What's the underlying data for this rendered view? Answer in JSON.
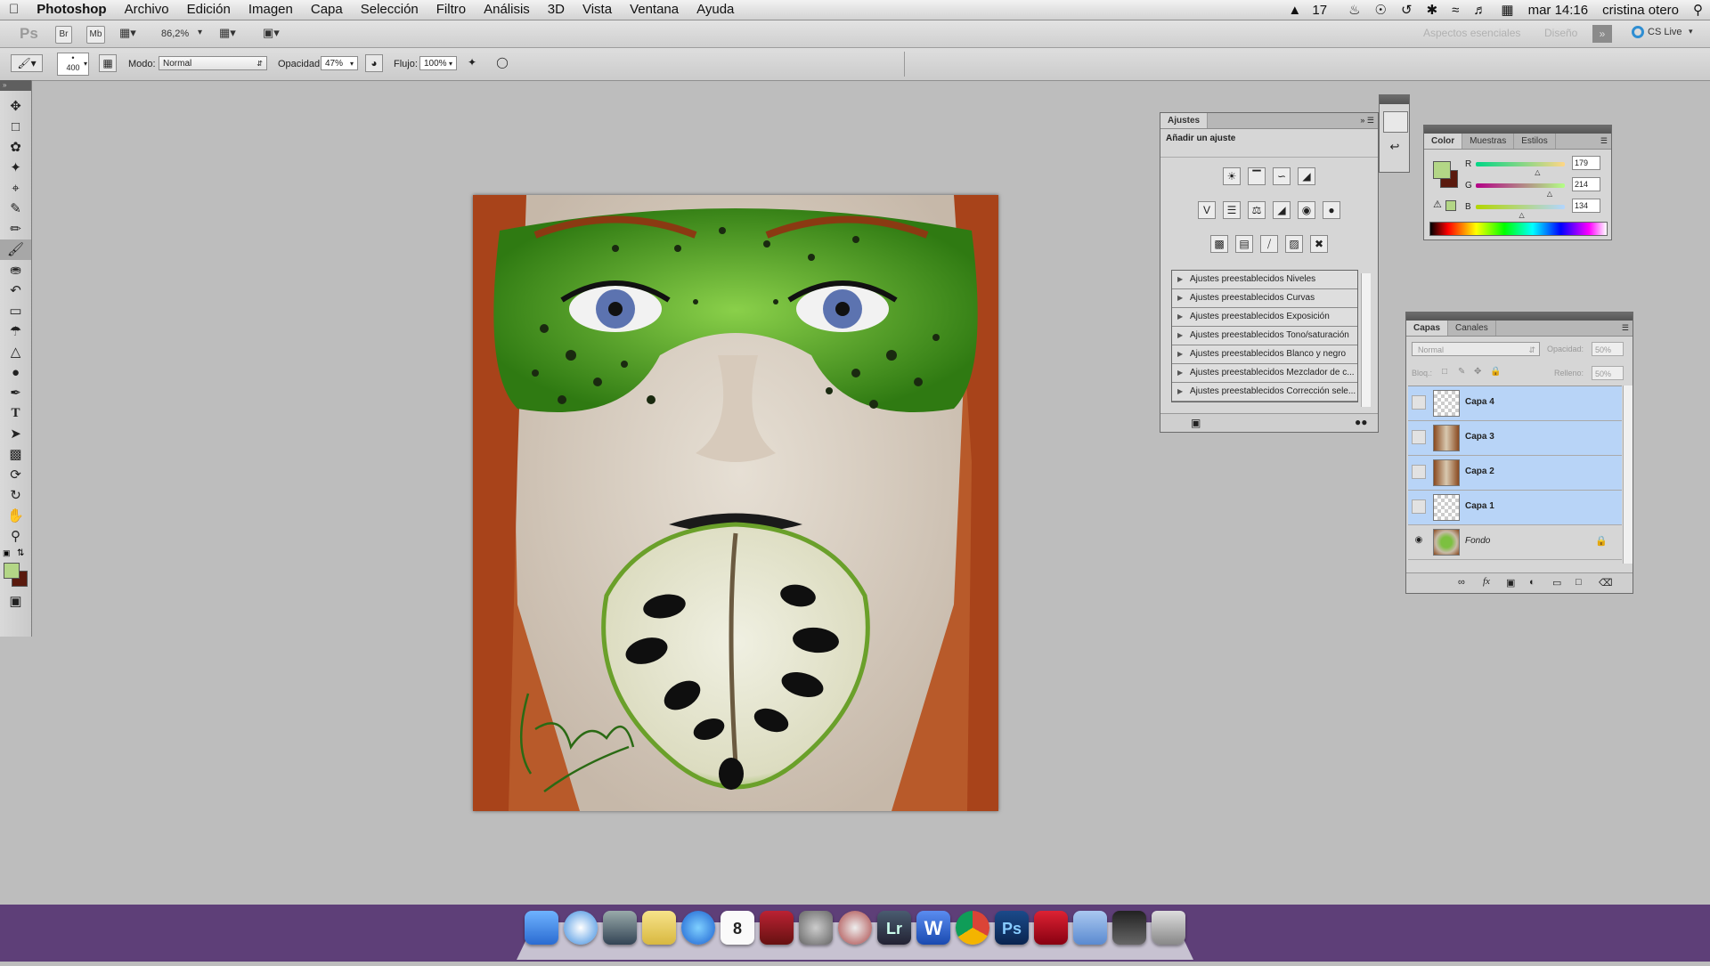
{
  "menubar": {
    "app_name": "Photoshop",
    "items": [
      "Archivo",
      "Edición",
      "Imagen",
      "Capa",
      "Selección",
      "Filtro",
      "Análisis",
      "3D",
      "Vista",
      "Ventana",
      "Ayuda"
    ],
    "status_badge": "17",
    "clock": "mar 14:16",
    "user": "cristina otero"
  },
  "appbar": {
    "ps_label": "Ps",
    "br_label": "Br",
    "mb_label": "Mb",
    "zoom": "86,2%",
    "workspace_essentials": "Aspectos esenciales",
    "workspace_design": "Diseño",
    "cs_live": "CS Live"
  },
  "options": {
    "brush_size": "400",
    "mode_label": "Modo:",
    "mode_value": "Normal",
    "opacity_label": "Opacidad:",
    "opacity_value": "47%",
    "flow_label": "Flujo:",
    "flow_value": "100%"
  },
  "adjustments": {
    "tab": "Ajustes",
    "heading": "Añadir un ajuste",
    "presets": [
      "Ajustes preestablecidos Niveles",
      "Ajustes preestablecidos Curvas",
      "Ajustes preestablecidos Exposición",
      "Ajustes preestablecidos Tono/saturación",
      "Ajustes preestablecidos Blanco y negro",
      "Ajustes preestablecidos Mezclador de c...",
      "Ajustes preestablecidos Corrección sele..."
    ]
  },
  "color": {
    "tabs": [
      "Color",
      "Muestras",
      "Estilos"
    ],
    "r_label": "R",
    "g_label": "G",
    "b_label": "B",
    "r": "179",
    "g": "214",
    "b": "134",
    "foreground": "#b3d686",
    "background": "#5a1a0e"
  },
  "layers": {
    "tabs": [
      "Capas",
      "Canales"
    ],
    "blend_mode": "Normal",
    "opacity_label": "Opacidad:",
    "opacity_value": "50%",
    "lock_label": "Bloq.:",
    "fill_label": "Relleno:",
    "fill_value": "50%",
    "items": [
      {
        "name": "Capa 4",
        "selected": true,
        "thumb": "transparent"
      },
      {
        "name": "Capa 3",
        "selected": true,
        "thumb": "photo"
      },
      {
        "name": "Capa 2",
        "selected": true,
        "thumb": "photo"
      },
      {
        "name": "Capa 1",
        "selected": true,
        "thumb": "transparent"
      },
      {
        "name": "Fondo",
        "selected": false,
        "thumb": "face"
      }
    ]
  },
  "dock": {
    "apps": [
      "finder-icon",
      "safari-icon",
      "facetime-icon",
      "notes-icon",
      "itunes-icon",
      "calendar-icon",
      "photobooth-icon",
      "system-preferences-icon",
      "time-machine-icon",
      "lightroom-icon",
      "word-icon",
      "chrome-icon",
      "photoshop-icon",
      "acrobat-icon",
      "folder-icon",
      "preview-icon",
      "trash-icon"
    ],
    "calendar_day": "8",
    "lr_label": "Lr",
    "ps_label": "Ps"
  }
}
